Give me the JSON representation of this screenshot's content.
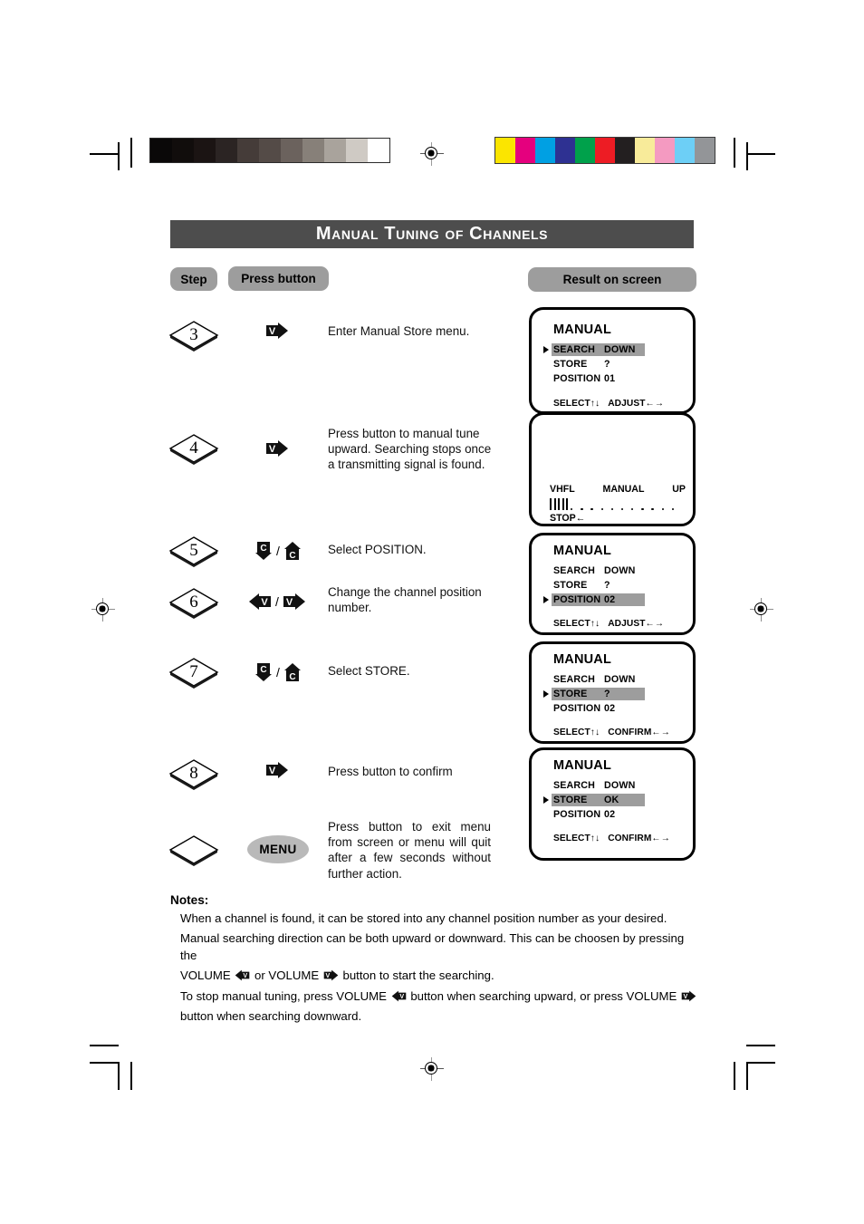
{
  "page": {
    "title": "Manual Tuning of Channels",
    "headers": {
      "step": "Step",
      "press_button": "Press button",
      "result_on_screen": "Result on screen"
    }
  },
  "calibration": {
    "gray_patches": [
      "#0a0808",
      "#110d0c",
      "#1b1413",
      "#2b2423",
      "#453c39",
      "#544b47",
      "#6b625d",
      "#878079",
      "#a9a39c",
      "#cfcac4",
      "#ffffff"
    ],
    "color_patches": [
      "#fbe500",
      "#e5007e",
      "#00a0e3",
      "#2e3192",
      "#00a14b",
      "#ed1c24",
      "#231f20",
      "#f8eb9a",
      "#f49ac1",
      "#6dcff6",
      "#939598"
    ]
  },
  "steps": [
    {
      "number": "3",
      "buttons": [
        "volume-right"
      ],
      "description": "Enter Manual Store menu."
    },
    {
      "number": "4",
      "buttons": [
        "volume-right"
      ],
      "description": "Press button to manual tune upward. Searching stops once a transmitting signal is found."
    },
    {
      "number": "5",
      "buttons": [
        "channel-down",
        "channel-up"
      ],
      "description": "Select POSITION."
    },
    {
      "number": "6",
      "buttons": [
        "volume-left",
        "volume-right"
      ],
      "description": "Change the channel position number."
    },
    {
      "number": "7",
      "buttons": [
        "channel-down",
        "channel-up"
      ],
      "description": "Select STORE."
    },
    {
      "number": "8",
      "buttons": [
        "volume-right"
      ],
      "description": "Press button to confirm"
    },
    {
      "number": "",
      "buttons": [
        "menu"
      ],
      "menu_label": "MENU",
      "description": "Press button to exit menu from screen or menu will quit after a few seconds without further action."
    }
  ],
  "screens": [
    {
      "id": "screen-step3",
      "type": "menu",
      "title": "MANUAL",
      "rows": [
        {
          "label": "SEARCH",
          "value": "DOWN",
          "selected": true
        },
        {
          "label": "STORE",
          "value": "?",
          "selected": false
        },
        {
          "label": "POSITION",
          "value": "01",
          "selected": false
        }
      ],
      "footer_left": "SELECT↑↓",
      "footer_right": "ADJUST←→"
    },
    {
      "id": "screen-step4",
      "type": "tuning",
      "band": "VHFL",
      "mode": "MANUAL",
      "direction": "UP",
      "stop": "STOP←",
      "meter_bars": 5,
      "meter_dots": 11
    },
    {
      "id": "screen-step6",
      "type": "menu",
      "title": "MANUAL",
      "rows": [
        {
          "label": "SEARCH",
          "value": "DOWN",
          "selected": false
        },
        {
          "label": "STORE",
          "value": "?",
          "selected": false
        },
        {
          "label": "POSITION",
          "value": "02",
          "selected": true
        }
      ],
      "footer_left": "SELECT↑↓",
      "footer_right": "ADJUST←→"
    },
    {
      "id": "screen-step7",
      "type": "menu",
      "title": "MANUAL",
      "rows": [
        {
          "label": "SEARCH",
          "value": "DOWN",
          "selected": false
        },
        {
          "label": "STORE",
          "value": "?",
          "selected": true
        },
        {
          "label": "POSITION",
          "value": "02",
          "selected": false
        }
      ],
      "footer_left": "SELECT↑↓",
      "footer_right": "CONFIRM←→"
    },
    {
      "id": "screen-step8",
      "type": "menu",
      "title": "MANUAL",
      "rows": [
        {
          "label": "SEARCH",
          "value": "DOWN",
          "selected": false
        },
        {
          "label": "STORE",
          "value": "OK",
          "selected": true
        },
        {
          "label": "POSITION",
          "value": "02",
          "selected": false
        }
      ],
      "footer_left": "SELECT↑↓",
      "footer_right": "CONFIRM←→"
    }
  ],
  "notes": {
    "heading": "Notes:",
    "line1": "When a channel is found, it can be stored into any channel position number as your desired.",
    "line2": "Manual searching direction can be both upward or downward. This can be choosen by pressing the",
    "line3a": "VOLUME",
    "line3b": "or VOLUME",
    "line3c": "button to start the searching.",
    "line4a": "To stop manual tuning, press VOLUME",
    "line4b": "button when searching upward, or press VOLUME",
    "line4c": "button when searching downward."
  }
}
